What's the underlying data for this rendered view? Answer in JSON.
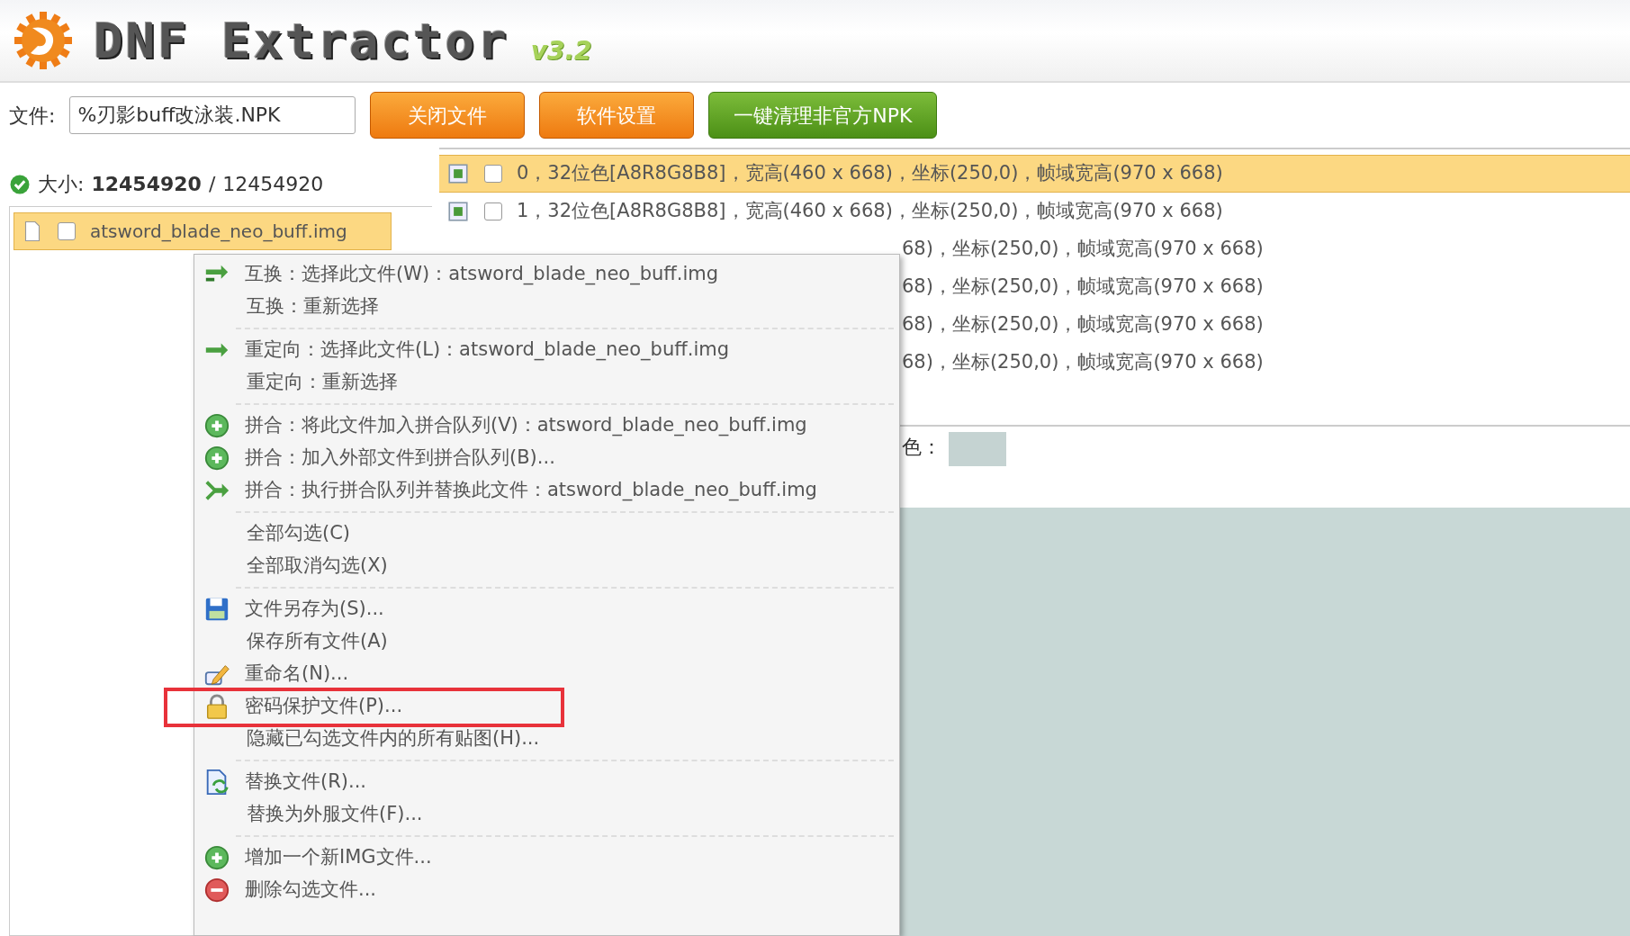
{
  "header": {
    "title": "DNF Extractor",
    "version": "v3.2"
  },
  "toolbar": {
    "file_label": "文件:",
    "file_value": "%刃影buff改泳装.NPK",
    "buttons": [
      {
        "label": "关闭文件",
        "kind": "orange"
      },
      {
        "label": "软件设置",
        "kind": "orange"
      },
      {
        "label": "一键清理非官方NPK",
        "kind": "green"
      }
    ]
  },
  "size": {
    "label": "大小:",
    "value": "12454920",
    "separator": "/",
    "total": "12454920"
  },
  "tree": {
    "items": [
      {
        "name": "atsword_blade_neo_buff.img",
        "selected": true,
        "checked": false
      }
    ]
  },
  "frames": {
    "rows": [
      {
        "kind": "full",
        "selected": true,
        "checked": false,
        "text": "0，32位色[A8R8G8B8]，宽高(460 x 668)，坐标(250,0)，帧域宽高(970 x 668)"
      },
      {
        "kind": "full",
        "selected": false,
        "checked": false,
        "text": "1，32位色[A8R8G8B8]，宽高(460 x 668)，坐标(250,0)，帧域宽高(970 x 668)"
      },
      {
        "kind": "clipped",
        "selected": false,
        "text": "68)，坐标(250,0)，帧域宽高(970 x 668)"
      },
      {
        "kind": "clipped",
        "selected": false,
        "text": "68)，坐标(250,0)，帧域宽高(970 x 668)"
      },
      {
        "kind": "clipped",
        "selected": false,
        "text": "68)，坐标(250,0)，帧域宽高(970 x 668)"
      },
      {
        "kind": "clipped",
        "selected": false,
        "text": "68)，坐标(250,0)，帧域宽高(970 x 668)"
      }
    ]
  },
  "background": {
    "label": "色：",
    "color": "#c5d3d2"
  },
  "context_menu": {
    "items": [
      {
        "kind": "swap",
        "label": "互换：选择此文件(W)：atsword_blade_neo_buff.img",
        "highlighted": false
      },
      {
        "kind": "plain",
        "label": "互换：重新选择",
        "highlighted": false
      },
      {
        "kind": "separator"
      },
      {
        "kind": "arrow",
        "label": "重定向：选择此文件(L)：atsword_blade_neo_buff.img",
        "highlighted": false
      },
      {
        "kind": "plain",
        "label": "重定向：重新选择",
        "highlighted": false
      },
      {
        "kind": "separator"
      },
      {
        "kind": "plus",
        "label": "拼合：将此文件加入拼合队列(V)：atsword_blade_neo_buff.img",
        "highlighted": false
      },
      {
        "kind": "plus",
        "label": "拼合：加入外部文件到拼合队列(B)...",
        "highlighted": false
      },
      {
        "kind": "merge",
        "label": "拼合：执行拼合队列并替换此文件：atsword_blade_neo_buff.img",
        "highlighted": false
      },
      {
        "kind": "separator"
      },
      {
        "kind": "plain",
        "label": "全部勾选(C)",
        "highlighted": false
      },
      {
        "kind": "plain",
        "label": "全部取消勾选(X)",
        "highlighted": false
      },
      {
        "kind": "separator"
      },
      {
        "kind": "save",
        "label": "文件另存为(S)...",
        "highlighted": false
      },
      {
        "kind": "plain",
        "label": "保存所有文件(A)",
        "highlighted": false
      },
      {
        "kind": "pencil",
        "label": "重命名(N)...",
        "highlighted": false
      },
      {
        "kind": "lock",
        "label": "密码保护文件(P)...",
        "highlighted": true
      },
      {
        "kind": "plain",
        "label": "隐藏已勾选文件内的所有贴图(H)...",
        "highlighted": false
      },
      {
        "kind": "separator"
      },
      {
        "kind": "replace",
        "label": "替换文件(R)...",
        "highlighted": false
      },
      {
        "kind": "plain",
        "label": "替换为外服文件(F)...",
        "highlighted": false
      },
      {
        "kind": "separator"
      },
      {
        "kind": "plus",
        "label": "增加一个新IMG文件...",
        "highlighted": false
      },
      {
        "kind": "minus",
        "label": "删除勾选文件...",
        "highlighted": false
      }
    ]
  }
}
